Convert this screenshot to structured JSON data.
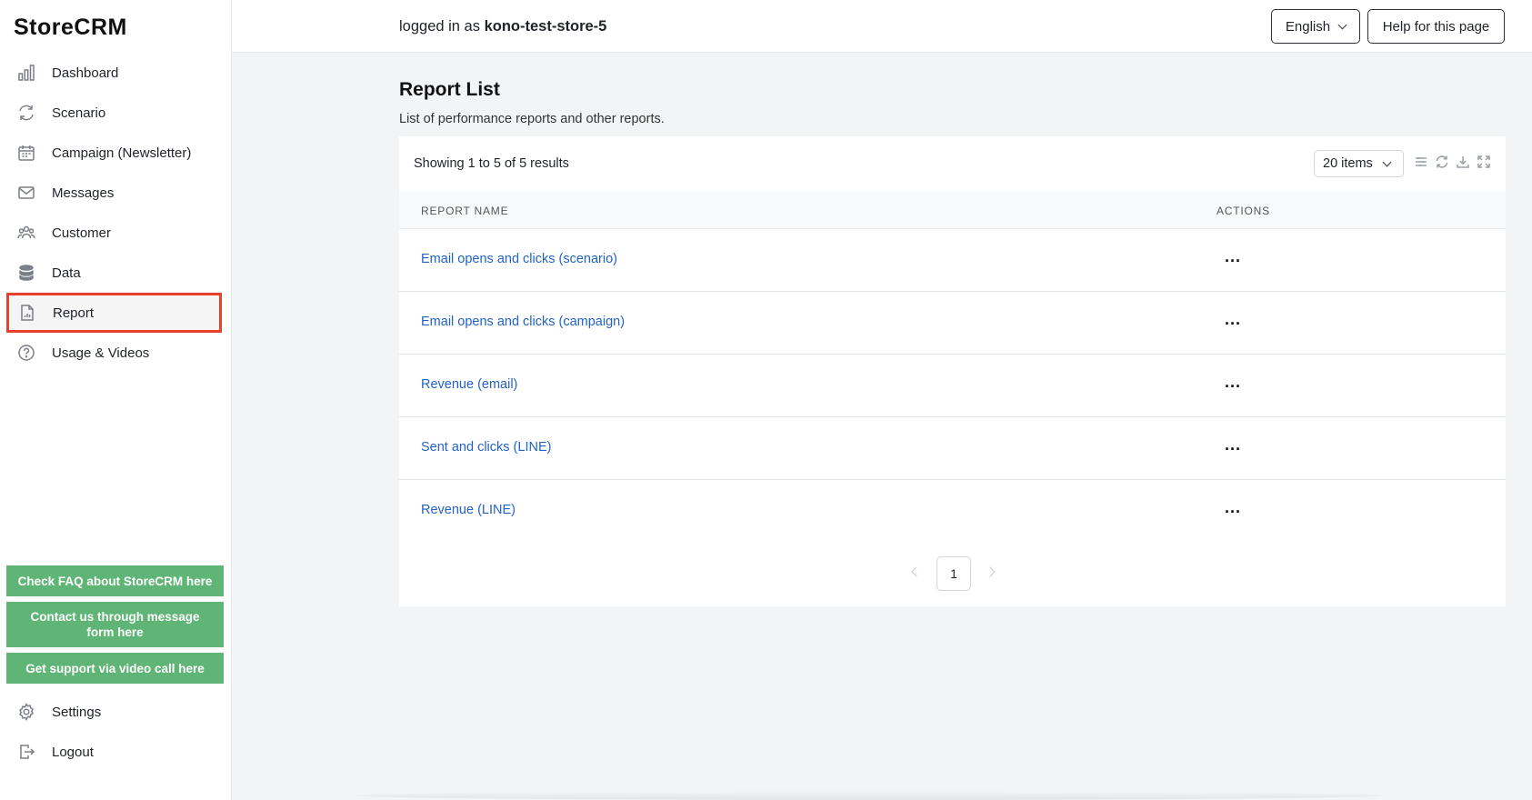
{
  "app": {
    "logo": "StoreCRM"
  },
  "sidebar": {
    "items": [
      {
        "label": "Dashboard",
        "icon": "bar-chart-icon"
      },
      {
        "label": "Scenario",
        "icon": "refresh-cycle-icon"
      },
      {
        "label": "Campaign (Newsletter)",
        "icon": "calendar-icon"
      },
      {
        "label": "Messages",
        "icon": "envelope-icon"
      },
      {
        "label": "Customer",
        "icon": "users-icon"
      },
      {
        "label": "Data",
        "icon": "database-icon"
      },
      {
        "label": "Report",
        "icon": "document-chart-icon",
        "active": true
      },
      {
        "label": "Usage & Videos",
        "icon": "question-circle-icon"
      }
    ],
    "support": {
      "faq": "Check FAQ about StoreCRM here",
      "contact": "Contact us through message form here",
      "video": "Get support via video call here"
    },
    "settings_label": "Settings",
    "logout_label": "Logout",
    "support_color": "#5fb575",
    "highlight_color": "#e8402a"
  },
  "topbar": {
    "login_prefix": "logged in as",
    "store_name": "kono-test-store-5",
    "language": "English",
    "help": "Help for this page"
  },
  "main": {
    "title": "Report List",
    "subtitle": "List of performance reports and other reports.",
    "showing": "Showing 1 to 5 of 5 results",
    "page_size": "20 items",
    "columns": {
      "name": "REPORT NAME",
      "actions": "ACTIONS"
    },
    "rows": [
      {
        "name": "Email opens and clicks (scenario)",
        "actions": "..."
      },
      {
        "name": "Email opens and clicks (campaign)",
        "actions": "..."
      },
      {
        "name": "Revenue (email)",
        "actions": "..."
      },
      {
        "name": "Sent and clicks (LINE)",
        "actions": "..."
      },
      {
        "name": "Revenue (LINE)",
        "actions": "..."
      }
    ],
    "pagination": {
      "current": "1"
    },
    "link_color": "#2362c7"
  }
}
